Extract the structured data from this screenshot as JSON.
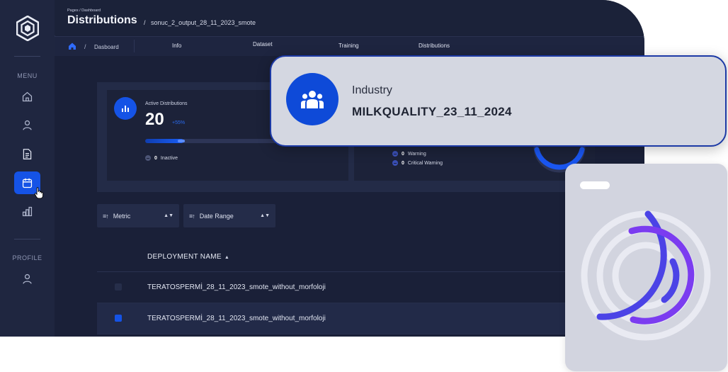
{
  "sidebar": {
    "menu_label": "MENU",
    "profile_label": "PROFILE",
    "items": [
      {
        "icon": "home-icon"
      },
      {
        "icon": "user-icon"
      },
      {
        "icon": "document-icon"
      },
      {
        "icon": "calendar-icon",
        "active": true
      },
      {
        "icon": "bar-chart-icon"
      }
    ],
    "profile_item": {
      "icon": "user-icon"
    }
  },
  "header": {
    "breadcrumb_small": "Pages / Dashboard",
    "title": "Distributions",
    "separator": "/",
    "subtitle": "sonuc_2_output_28_11_2023_smote"
  },
  "nav": {
    "separator": "/",
    "dashboard": "Dasboard",
    "tabs": [
      "Info",
      "Dataset",
      "Training",
      "Distributions"
    ]
  },
  "cards": {
    "active": {
      "label": "Active Distributions",
      "value": "20",
      "delta": "+55%",
      "progress": 0.2,
      "inactive_count": "0",
      "inactive_label": "Inactive"
    },
    "warnings": {
      "warning_count": "0",
      "warning_label": "Warning",
      "critical_count": "0",
      "critical_label": "Critical Warning"
    }
  },
  "filters": {
    "metric": "Metric",
    "date_range": "Date Range"
  },
  "table": {
    "header": "DEPLOYMENT NAME",
    "rows": [
      {
        "name": "TERATOSPERMİ_28_11_2023_smote_without_morfoloji",
        "selected": false
      },
      {
        "name": "TERATOSPERMİ_28_11_2023_smote_without_morfoloji",
        "selected": true
      }
    ]
  },
  "industry": {
    "label": "Industry",
    "value": "MILKQUALITY_23_11_2024"
  },
  "colors": {
    "accent": "#1553e6",
    "background": "#1a2038",
    "ring_purple": "#7b3cf0",
    "ring_blue": "#3b4fe0"
  }
}
